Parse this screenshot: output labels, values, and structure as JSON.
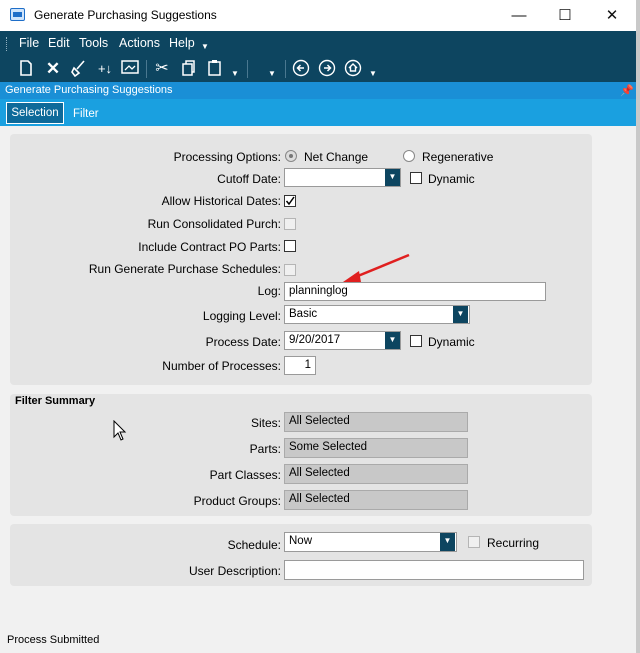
{
  "window": {
    "title": "Generate Purchasing Suggestions",
    "minimize": "—",
    "maximize": "☐",
    "close": "✕"
  },
  "menu": [
    {
      "label": "File"
    },
    {
      "label": "Edit"
    },
    {
      "label": "Tools"
    },
    {
      "label": "Actions"
    },
    {
      "label": "Help"
    }
  ],
  "toolbar": {
    "icons": [
      "new-icon",
      "delete-icon",
      "clear-icon",
      "attach-icon",
      "preview-icon",
      "cut-icon",
      "copy-icon",
      "paste-icon",
      "back-icon",
      "forward-icon",
      "home-icon"
    ]
  },
  "form_header": "Generate Purchasing Suggestions",
  "tabs": [
    {
      "label": "Selection"
    },
    {
      "label": "Filter"
    }
  ],
  "selection": {
    "processing_options_label": "Processing Options:",
    "net_change": "Net Change",
    "regenerative": "Regenerative",
    "cutoff_date_label": "Cutoff Date:",
    "cutoff_date_value": "",
    "dynamic_label": "Dynamic",
    "allow_historical_label": "Allow Historical Dates:",
    "allow_historical_checked": true,
    "run_consolidated_label": "Run Consolidated Purch:",
    "include_contract_label": "Include Contract PO Parts:",
    "run_schedules_label": "Run Generate Purchase Schedules:",
    "log_label": "Log:",
    "log_value": "planninglog",
    "logging_level_label": "Logging Level:",
    "logging_level_value": "Basic",
    "process_date_label": "Process Date:",
    "process_date_value": "9/20/2017",
    "process_date_dynamic": "Dynamic",
    "num_processes_label": "Number of Processes:",
    "num_processes_value": "1"
  },
  "filter_summary": {
    "title": "Filter Summary",
    "sites_label": "Sites:",
    "sites_value": "All Selected",
    "parts_label": "Parts:",
    "parts_value": "Some Selected",
    "part_classes_label": "Part Classes:",
    "part_classes_value": "All Selected",
    "product_groups_label": "Product Groups:",
    "product_groups_value": "All Selected"
  },
  "schedule": {
    "schedule_label": "Schedule:",
    "schedule_value": "Now",
    "recurring_label": "Recurring",
    "user_description_label": "User Description:",
    "user_description_value": ""
  },
  "status": "Process Submitted",
  "colors": {
    "menubar": "#0d4560",
    "tabbar": "#1aa0e0",
    "annotation_arrow": "#e02020"
  }
}
